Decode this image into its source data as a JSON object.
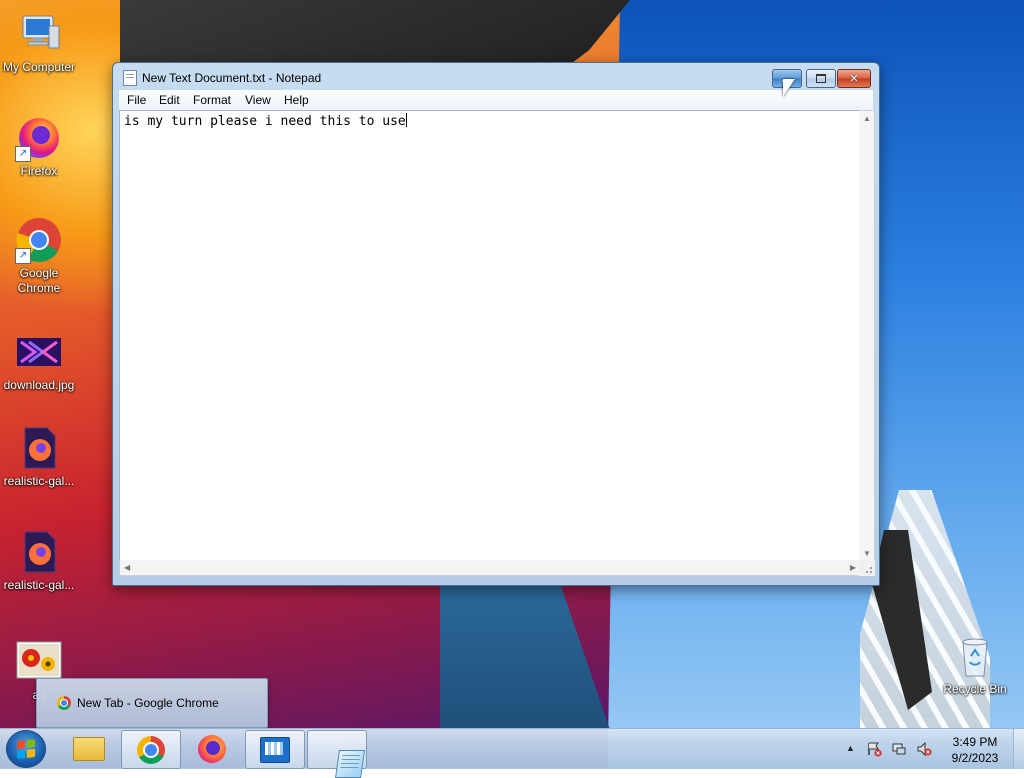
{
  "desktop": {
    "icons": [
      {
        "label": "My Computer"
      },
      {
        "label": "Firefox"
      },
      {
        "label": "Google Chrome"
      },
      {
        "label": "download.jpg"
      },
      {
        "label": "realistic-gal..."
      },
      {
        "label": "realistic-gal..."
      },
      {
        "label": "a.j"
      },
      {
        "label": "Recycle Bin"
      }
    ]
  },
  "notepad": {
    "title": "New Text Document.txt - Notepad",
    "menu": [
      "File",
      "Edit",
      "Format",
      "View",
      "Help"
    ],
    "content": "is my turn please i need this to use",
    "caption_buttons": {
      "minimize": "minimize-icon",
      "maximize": "maximize-icon",
      "close": "close-icon"
    }
  },
  "chrome_popup": {
    "label": "New Tab - Google Chrome"
  },
  "taskbar": {
    "pinned": [
      {
        "icon": "windows-explorer-icon"
      },
      {
        "icon": "chrome-icon"
      },
      {
        "icon": "firefox-icon"
      },
      {
        "icon": "control-panel-icon"
      },
      {
        "icon": "notepad-icon"
      }
    ],
    "tray": {
      "icons": [
        "action-center-icon",
        "network-icon",
        "volume-muted-icon"
      ]
    },
    "clock": {
      "time": "3:49 PM",
      "date": "9/2/2023"
    }
  },
  "colors": {
    "accent": "#3d7fc6",
    "close": "#c53d1c"
  }
}
